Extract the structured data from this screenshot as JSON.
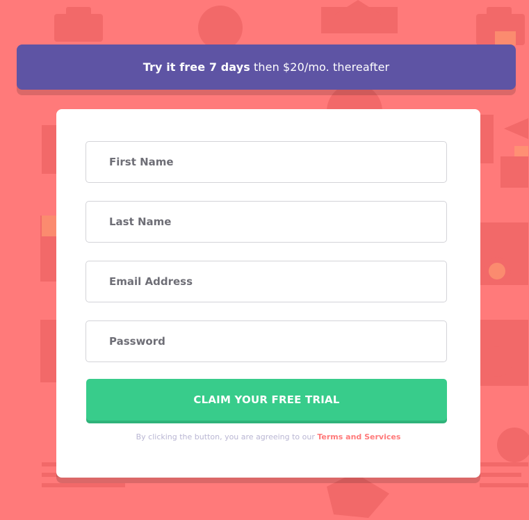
{
  "banner": {
    "highlight": "Try it free 7 days",
    "rest": "then $20/mo. thereafter"
  },
  "form": {
    "fields": [
      {
        "placeholder": "First Name",
        "type": "text"
      },
      {
        "placeholder": "Last Name",
        "type": "text"
      },
      {
        "placeholder": "Email Address",
        "type": "email"
      },
      {
        "placeholder": "Password",
        "type": "password"
      }
    ],
    "submit_label": "CLAIM YOUR FREE TRIAL",
    "terms_prefix": "By clicking the button, you are agreeing to our",
    "terms_link": "Terms and Services"
  },
  "colors": {
    "background": "#ff7a7a",
    "banner": "#5e54a4",
    "cta": "#38cc8b",
    "link": "#ff7a7a"
  }
}
